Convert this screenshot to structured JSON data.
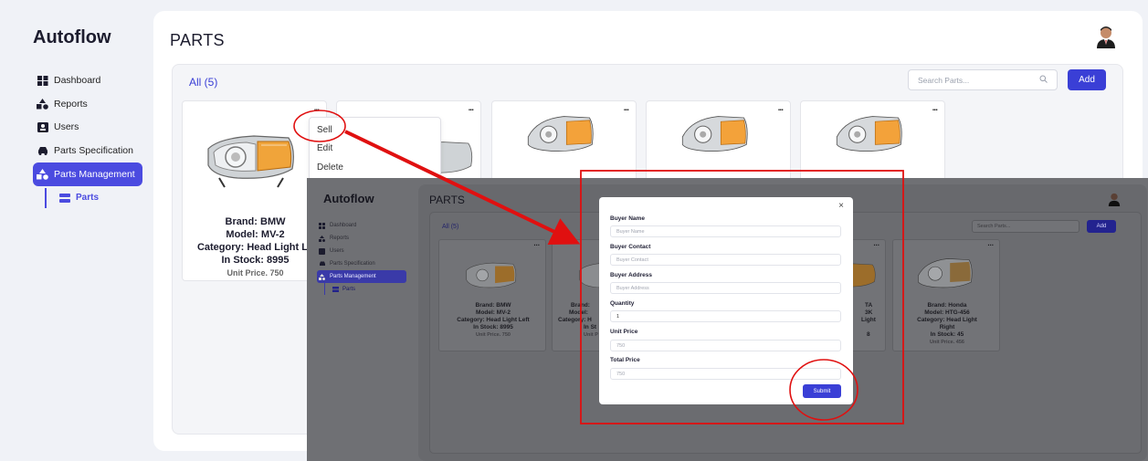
{
  "app": {
    "name": "Autoflow",
    "page_title": "PARTS"
  },
  "sidebar": {
    "items": [
      {
        "label": "Dashboard",
        "icon": "dashboard-icon"
      },
      {
        "label": "Reports",
        "icon": "reports-icon"
      },
      {
        "label": "Users",
        "icon": "users-icon"
      },
      {
        "label": "Parts Specification",
        "icon": "car-icon"
      },
      {
        "label": "Parts Management",
        "icon": "parts-management-icon",
        "active": true
      }
    ],
    "sub_item": {
      "label": "Parts",
      "icon": "list-icon"
    }
  },
  "toolbar": {
    "all_label": "All (5)",
    "search_placeholder": "Search Parts...",
    "add_label": "Add"
  },
  "cards": [
    {
      "brand": "Brand: BMW",
      "model": "Model: MV-2",
      "category": "Category: Head Light Le",
      "stock": "In Stock: 8995",
      "price": "Unit Price. 750"
    }
  ],
  "menu_dots": "...",
  "context_menu": {
    "items": [
      "Sell",
      "Edit",
      "Delete"
    ]
  },
  "overlay": {
    "app_name": "Autoflow",
    "page_title": "PARTS",
    "sidebar_items": [
      "Dashboard",
      "Reports",
      "Users",
      "Parts Specification",
      "Parts Management"
    ],
    "sub_item": "Parts",
    "all_label": "All (5)",
    "search_placeholder": "Search Parts...",
    "add_label": "Add",
    "cards": [
      {
        "brand": "Brand: BMW",
        "model": "Model: MV-2",
        "category": "Category: Head Light Left",
        "stock": "In Stock: 8995",
        "price": "Unit Price. 750"
      },
      {
        "brand": "Brand:",
        "model": "Model:",
        "category": "Category: H",
        "stock": "In St",
        "price": "Unit P"
      },
      {
        "brand": "TA",
        "model": "3K",
        "category": "Light",
        "stock": "8",
        "price": ""
      },
      {
        "brand": "Brand: Honda",
        "model": "Model: HTG-456",
        "category": "Category: Head Light",
        "category2": "Right",
        "stock": "In Stock: 45",
        "price": "Unit Price. 456"
      }
    ]
  },
  "modal": {
    "close": "×",
    "fields": [
      {
        "label": "Buyer Name",
        "placeholder": "Buyer Name",
        "value": ""
      },
      {
        "label": "Buyer Contact",
        "placeholder": "Buyer Contact",
        "value": ""
      },
      {
        "label": "Buyer Address",
        "placeholder": "Buyer Address",
        "value": ""
      },
      {
        "label": "Quantity",
        "placeholder": "",
        "value": "1"
      },
      {
        "label": "Unit Price",
        "placeholder": "",
        "value": "750"
      },
      {
        "label": "Total Price",
        "placeholder": "",
        "value": "750"
      }
    ],
    "submit_label": "Submit"
  },
  "colors": {
    "accent": "#3a3fd6",
    "annotation": "#e01010",
    "overlay_dim": "#6f7074"
  }
}
